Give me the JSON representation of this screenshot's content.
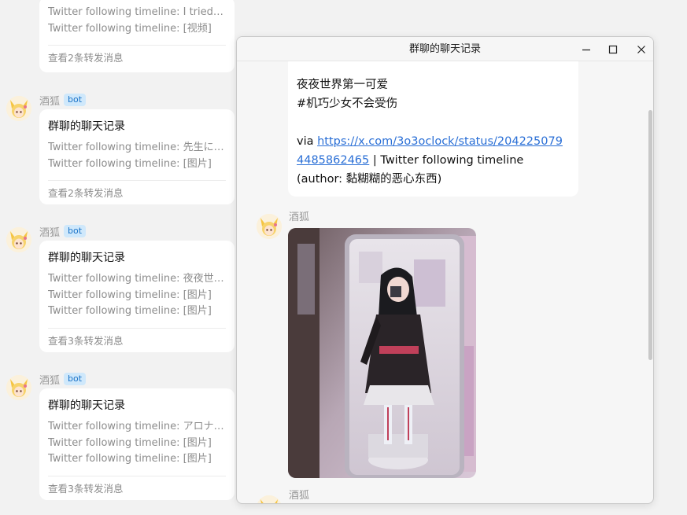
{
  "messages": [
    {
      "sender": "",
      "badge": "",
      "title": "",
      "lines": [
        "Twitter following timeline: I tried f…",
        "Twitter following timeline: [视频]"
      ],
      "footer": "查看2条转发消息"
    },
    {
      "sender": "酒狐",
      "badge": "bot",
      "title": "群聊的聊天记录",
      "lines": [
        "Twitter following timeline: 先生に…",
        "Twitter following timeline: [图片]"
      ],
      "footer": "查看2条转发消息"
    },
    {
      "sender": "酒狐",
      "badge": "bot",
      "title": "群聊的聊天记录",
      "lines": [
        "Twitter following timeline: 夜夜世…",
        "Twitter following timeline: [图片]",
        "Twitter following timeline: [图片]"
      ],
      "footer": "查看3条转发消息"
    },
    {
      "sender": "酒狐",
      "badge": "bot",
      "title": "群聊的聊天记录",
      "lines": [
        "Twitter following timeline: アロナ…",
        "Twitter following timeline: [图片]",
        "Twitter following timeline: [图片]"
      ],
      "footer": "查看3条转发消息"
    }
  ],
  "window": {
    "title": "群聊的聊天记录",
    "message_text": {
      "line1": "夜夜世界第一可爱",
      "line2": "#机巧少女不会受伤",
      "via_prefix": "via ",
      "link": "https://x.com/3o3oclock/status/2042250794485862465",
      "suffix": " | Twitter following timeline",
      "author": "(author: 黏糊糊的恶心东西)"
    },
    "photo_sender": "酒狐",
    "next_sender": "酒狐"
  },
  "colors": {
    "link": "#2a6fd6",
    "badge_bg": "#cfe8fb",
    "badge_text": "#1a73c8"
  },
  "icons": [
    "fox-girl-avatar-icon",
    "minimize-icon",
    "maximize-icon",
    "close-icon"
  ]
}
